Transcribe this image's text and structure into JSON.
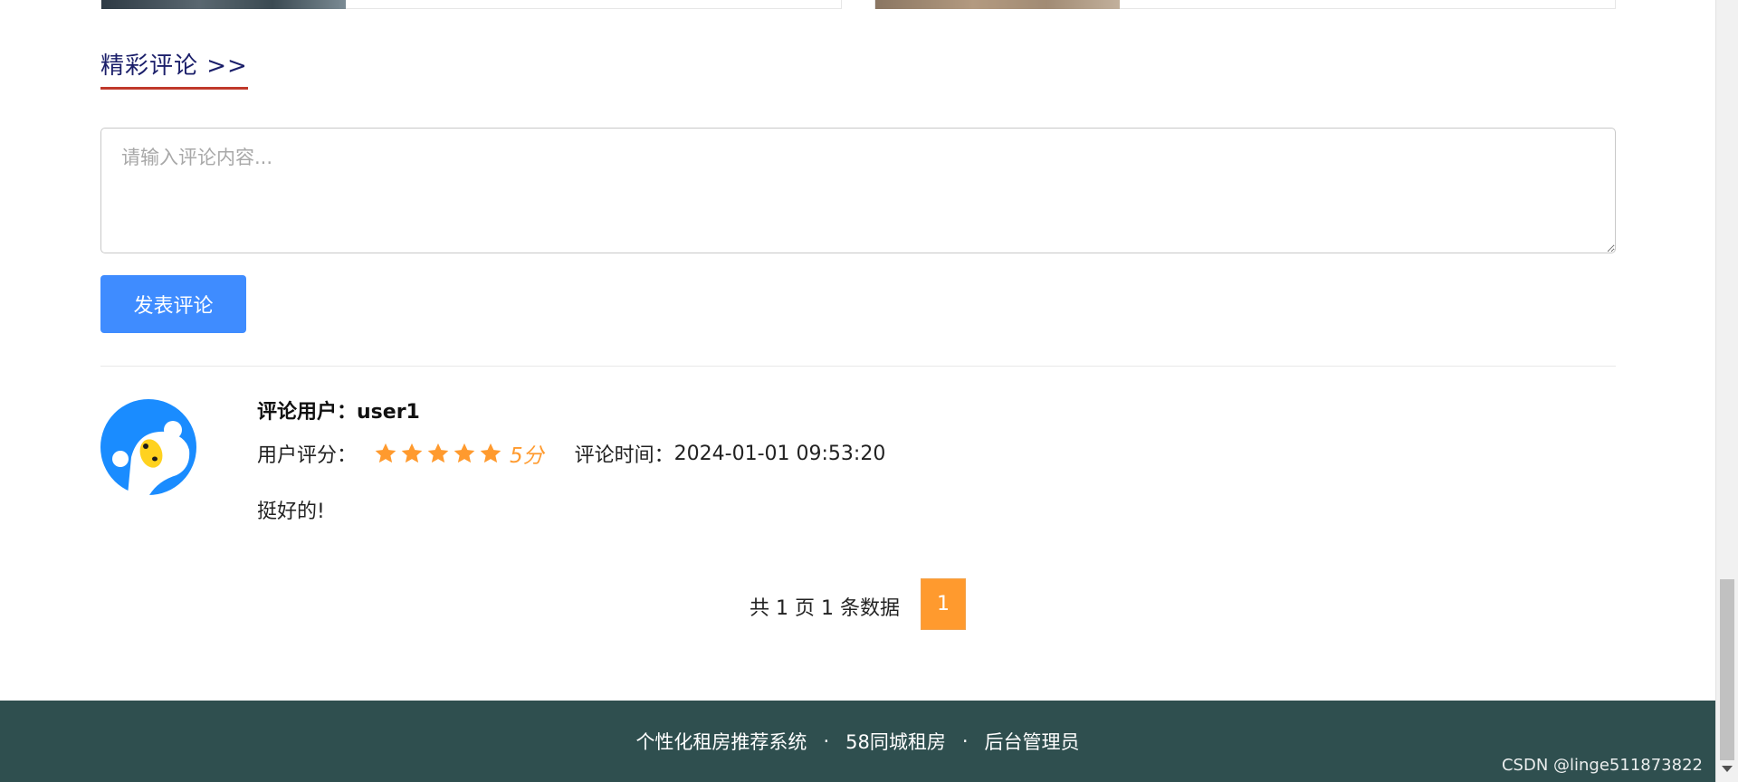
{
  "section": {
    "title": "精彩评论 >>"
  },
  "comment_form": {
    "placeholder": "请输入评论内容...",
    "submit_label": "发表评论"
  },
  "comments": [
    {
      "user_label": "评论用户：",
      "user": "user1",
      "rating_label": "用户评分：",
      "rating_stars": 5,
      "rating_text": "5分",
      "time_label": "评论时间：",
      "time": "2024-01-01 09:53:20",
      "text": "挺好的!"
    }
  ],
  "pagination": {
    "info": "共 1 页 1 条数据",
    "current_page": "1"
  },
  "footer": {
    "links": [
      "个性化租房推荐系统",
      "58同城租房",
      "后台管理员"
    ],
    "separator": "·"
  },
  "watermark": "CSDN @linge511873822",
  "colors": {
    "accent": "#3f8cff",
    "star": "#ff9a2e",
    "footer_bg": "#2f4f4f",
    "title_underline": "#c0392b"
  }
}
